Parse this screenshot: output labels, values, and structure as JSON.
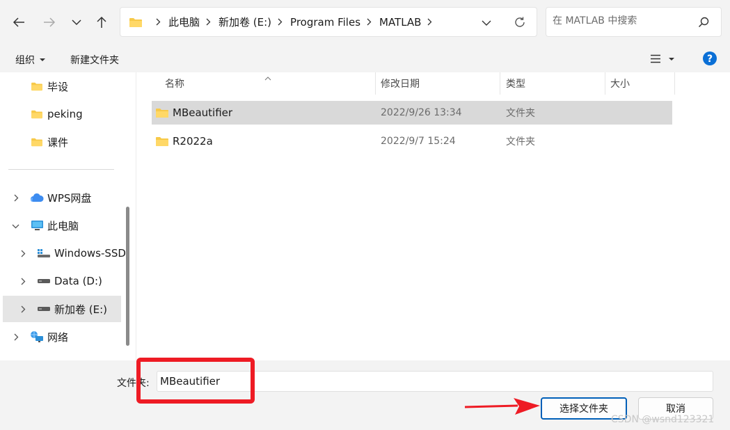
{
  "address": {
    "crumbs": [
      "此电脑",
      "新加卷 (E:)",
      "Program Files",
      "MATLAB"
    ]
  },
  "search": {
    "placeholder": "在 MATLAB 中搜索"
  },
  "toolbar": {
    "organize_label": "组织",
    "new_folder_label": "新建文件夹"
  },
  "nav": {
    "items": [
      {
        "label": "毕设"
      },
      {
        "label": "peking"
      },
      {
        "label": "课件"
      },
      {
        "label": "WPS网盘"
      },
      {
        "label": "此电脑"
      },
      {
        "label": "Windows-SSD"
      },
      {
        "label": "Data (D:)"
      },
      {
        "label": "新加卷 (E:)"
      },
      {
        "label": "网络"
      }
    ]
  },
  "columns": {
    "name": "名称",
    "date": "修改日期",
    "type": "类型",
    "size": "大小"
  },
  "files": [
    {
      "name": "MBeautifier",
      "date": "2022/9/26 13:34",
      "type": "文件夹"
    },
    {
      "name": "R2022a",
      "date": "2022/9/7 15:24",
      "type": "文件夹"
    }
  ],
  "bottom": {
    "filename_label": "文件夹:",
    "filename_value": "MBeautifier",
    "select_button": "选择文件夹",
    "cancel_button": "取消"
  },
  "watermark": "CSDN @wsnd123321",
  "colors": {
    "accent": "#005fb8",
    "highlight_red": "#ee1b24",
    "folder_yellow": "#f7c948",
    "help_blue": "#0a6fd6"
  }
}
